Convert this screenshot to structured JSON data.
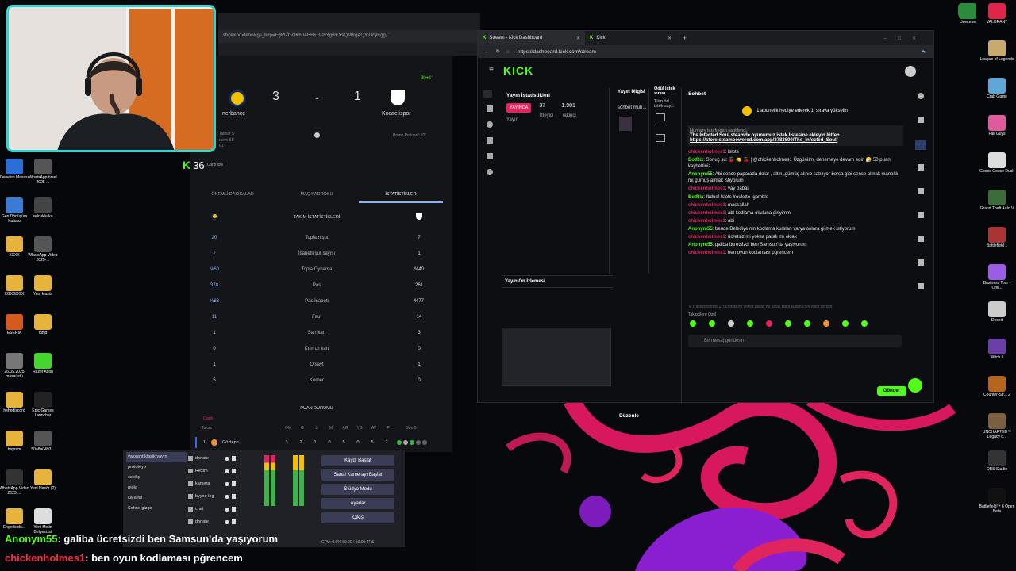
{
  "football": {
    "url": "shçe&oq=fene&gs_lcrp=EgRlZGdlKhIIABBFGDsYgwEYsQMYgAQY-OcyEgg...",
    "score_home": "3",
    "score_sep": "-",
    "score_away": "1",
    "home_team": "nerbahçe",
    "away_team": "Kocaelispor",
    "minute": "90+1'",
    "home_scorers": "Talinar 5'\nrsem 51'\n61'",
    "away_scorer": "Bruno Petković 22'",
    "watch_live_label": "Canlı izle",
    "watch_live_count": "36",
    "tabs": [
      "ÖNEMLİ DAKİKALAR",
      "MAÇ KADROSU",
      "İSTATİSTİKLER"
    ],
    "stats_title": "TAKIM İSTATİSTİKLERİ",
    "stats": [
      {
        "label": "Toplam şut",
        "home": "20",
        "away": "7"
      },
      {
        "label": "İsabetli şut sayısı",
        "home": "7",
        "away": "1"
      },
      {
        "label": "Topla Oynama",
        "home": "%60",
        "away": "%40"
      },
      {
        "label": "Pas",
        "home": "378",
        "away": "261"
      },
      {
        "label": "Pas İsabeti",
        "home": "%83",
        "away": "%77"
      },
      {
        "label": "Faul",
        "home": "11",
        "away": "14"
      },
      {
        "label": "Sarı kart",
        "home": "1",
        "away": "3"
      },
      {
        "label": "Kırmızı kart",
        "home": "0",
        "away": "0"
      },
      {
        "label": "Ofsayt",
        "home": "1",
        "away": "1"
      },
      {
        "label": "Korner",
        "home": "5",
        "away": "0"
      }
    ],
    "standings_title": "PUAN DURUMU",
    "standings_live": "Canlı",
    "standings_headers": [
      "Takım",
      "OM",
      "G",
      "B",
      "M",
      "AG",
      "YG",
      "AV",
      "P",
      "Son 5"
    ],
    "standings_row": {
      "rank": "1",
      "team": "Göztepe",
      "values": [
        "3",
        "2",
        "1",
        "0",
        "5",
        "0",
        "5",
        "7"
      ]
    }
  },
  "kick": {
    "tab1": "Stream - Kick Dashboard",
    "tab2": "Kick",
    "url": "https://dashboard.kick.com/stream",
    "logo": "KICK",
    "stream_stats_title": "Yayın İstatistikleri",
    "live_badge": "YAYINDA",
    "live_sub": "Yayın",
    "viewers": "37",
    "viewers_label": "İzleyici",
    "followers": "1.901",
    "followers_label": "Takipçi",
    "stream_info_title": "Yayın bilgisi",
    "stream_info_text": "sohbet muh...",
    "awards_title": "Ödül istek sırası",
    "awards_text": "Tüm öd... istek say...",
    "preview_title": "Yayın Ön İzlemesi",
    "edit_label": "Düzenle",
    "chat_title": "Sohbet",
    "gift_banner": "1 abonelik hediye ederek 1. sıraya yükselin",
    "pinned_by": "Hunrazy tarafından sabitlendi",
    "pinned_text": "The Infected Soul steamde oyunumuz istek listesine ekleyin lütfen",
    "pinned_link": "https://store.steampowered.com/app/3783800/The_Infected_Soul/",
    "chat": [
      {
        "user": "chickenholmes1",
        "cls": "red",
        "msg": ": lslots"
      },
      {
        "user": "BotRix",
        "cls": "green",
        "msg": ": Sonuç şu: 🍒 🍋 🍒 | @chickenholmes1 Üzgünüm, denemeye devam edin 🤧 50 puan kaybettiniz."
      },
      {
        "user": "Anonym55",
        "cls": "green",
        "msg": ": Abi sence paparada dolar , altın ,gümüş alınıp satılıyor borsa gibi sence almak mantıklı mı gümüş almak istiyorum"
      },
      {
        "user": "chickenholmes1",
        "cls": "red",
        "msg": ": vay babai"
      },
      {
        "user": "BotRix",
        "cls": "green",
        "msg": ": !bduel !slots !roulette !gamble"
      },
      {
        "user": "chickenholmes1",
        "cls": "red",
        "msg": ": massallah"
      },
      {
        "user": "chickenholmes1",
        "cls": "red",
        "msg": ": abi kodlama okuluna giriyimmi"
      },
      {
        "user": "chickenholmes1",
        "cls": "red",
        "msg": ": abi"
      },
      {
        "user": "Anonym55",
        "cls": "green",
        "msg": ": bende Belediye nin kodlama kursları varya onlara gitmek istiyorum"
      },
      {
        "user": "chickenholmes1",
        "cls": "red",
        "msg": ": ücretsiz mi yoksa paralı mı olcak"
      },
      {
        "user": "Anonym55",
        "cls": "green",
        "msg": ": galiba ücretsizdi ben Samsun'da yaşıyorum"
      },
      {
        "user": "chickenholmes1",
        "cls": "red",
        "msg": ": ben oyun kodlaması pğrencem"
      }
    ],
    "reply_hint": "↳ chickenholmes1: ücretsiz mi yoksa paralı mı olcak İstiril kullanıcıya yanıt veriyor",
    "followers_only": "Takipçilere Özel",
    "chat_placeholder": "Bir mesaj gönderin",
    "send_label": "Gönder"
  },
  "obs": {
    "scenes": [
      "valorant klasik yayın",
      "prototeyp",
      "çekiliş",
      "mola",
      "kara ful",
      "Sahne gizge"
    ],
    "sources": [
      "donate",
      "Resim",
      "kamera",
      "byyno log",
      "chat",
      "donate"
    ],
    "controls": [
      "Kaydı Başlat",
      "Sanal Kamerayı Başlat",
      "Stüdyo Modu",
      "Ayarlar",
      "Çıkış"
    ],
    "status": "CPU: 0.6%   60.00 / 60.00 FPS"
  },
  "overlay": [
    {
      "user": "Anonym55",
      "msg": ": galiba ücretsizdi ben Samsun'da yaşıyorum",
      "cls": "green"
    },
    {
      "user": "chickenholmes1",
      "msg": ": ben oyun kodlaması pğrencem",
      "cls": "red"
    }
  ],
  "desktop_left": [
    {
      "label": "Denetim Masası",
      "color": "#2a6fd6"
    },
    {
      "label": "WhatsApp örsel 2025-...",
      "color": "#555"
    },
    {
      "label": "Geri Dönüşüm Kutusu",
      "color": "#3a7bd5"
    },
    {
      "label": "selcuklu-ka",
      "color": "#444"
    },
    {
      "label": "XXXX",
      "color": "#e6b43c"
    },
    {
      "label": "WhatsApp Video 2025-...",
      "color": "#555"
    },
    {
      "label": "XGXGXGX",
      "color": "#e6b43c"
    },
    {
      "label": "Yeni klasör",
      "color": "#e6b43c"
    },
    {
      "label": "ESERIA",
      "color": "#d35b1e"
    },
    {
      "label": "fdhjd",
      "color": "#e6b43c"
    },
    {
      "label": "26.05.2025 masaüstü",
      "color": "#777"
    },
    {
      "label": "Razer Axon",
      "color": "#44d62c"
    },
    {
      "label": "hehediscord",
      "color": "#e6b43c"
    },
    {
      "label": "Epic Games Launcher",
      "color": "#222"
    },
    {
      "label": "bayram",
      "color": "#e6b43c"
    },
    {
      "label": "50a8a0493...",
      "color": "#555"
    },
    {
      "label": "WhatsApp Video 2025-...",
      "color": "#333"
    },
    {
      "label": "Yeni klasör (2)",
      "color": "#e6b43c"
    },
    {
      "label": "Engellerde...",
      "color": "#e6b43c"
    },
    {
      "label": "Yeni Metin Belgesi.txt",
      "color": "#ddd"
    }
  ],
  "desktop_right": [
    {
      "label": "cleer.exe",
      "color": "#2a8c3c"
    },
    {
      "label": "VALORANT",
      "color": "#e0244a"
    },
    {
      "label": "League of Legends",
      "color": "#c8aa6e"
    },
    {
      "label": "Crab Game",
      "color": "#5fa7d9"
    },
    {
      "label": "Fall Guys",
      "color": "#e05aa0"
    },
    {
      "label": "Goose Goose Duck",
      "color": "#ddd"
    },
    {
      "label": "Grand Theft Auto V",
      "color": "#3c6b3c"
    },
    {
      "label": "Battlefield 1",
      "color": "#a33"
    },
    {
      "label": "Business Tour - Onli...",
      "color": "#9b5de5"
    },
    {
      "label": "Deceit",
      "color": "#ccc"
    },
    {
      "label": "Witch It",
      "color": "#6c3fa8"
    },
    {
      "label": "Counter-Str... 2",
      "color": "#b5651d"
    },
    {
      "label": "UNCHARTED™ Legacy o...",
      "color": "#7a6040"
    },
    {
      "label": "OBS Studio",
      "color": "#333"
    },
    {
      "label": "Battlefield™ 6 Open Beta",
      "color": "#111"
    }
  ]
}
